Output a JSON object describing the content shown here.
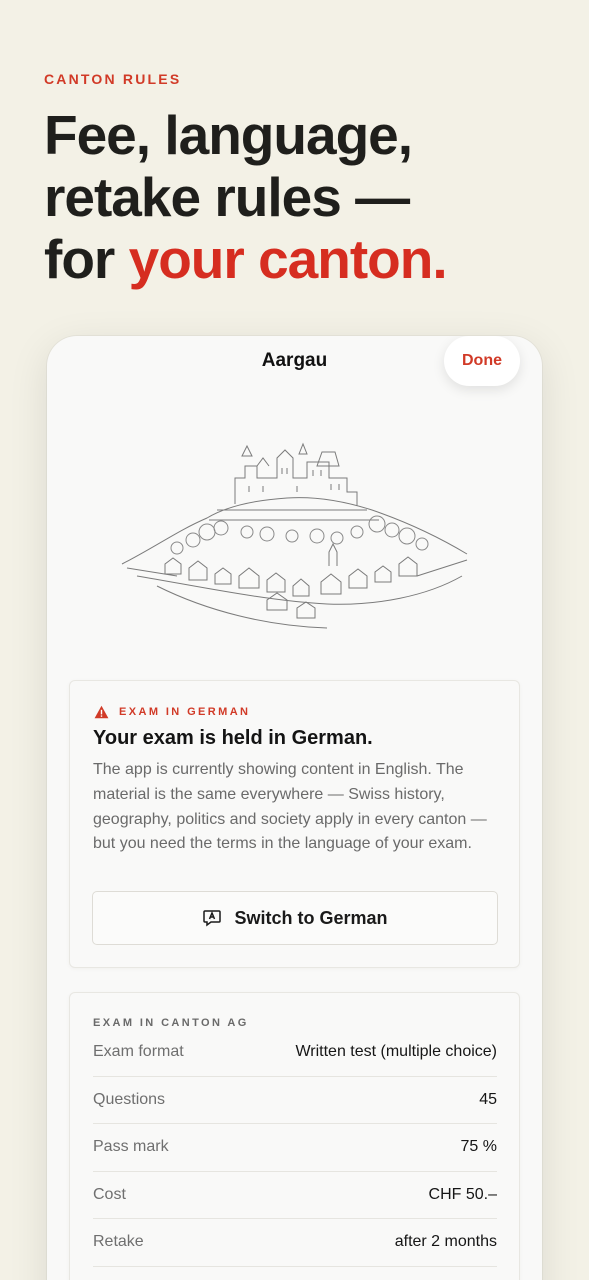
{
  "eyebrow": "CANTON RULES",
  "headline": {
    "line1": "Fee, language,",
    "line2": "retake rules —",
    "line3_prefix": "for ",
    "line3_accent": "your canton."
  },
  "nav": {
    "title": "Aargau",
    "done_label": "Done"
  },
  "alert": {
    "label": "EXAM IN GERMAN",
    "icon": "warning-icon",
    "title": "Your exam is held in German.",
    "body": "The app is currently showing content in English. The material is the same everywhere — Swiss history, geography, politics and society apply in every canton — but you need the terms in the language of your exam.",
    "button_label": "Switch to German",
    "button_icon": "translate-icon"
  },
  "exam_info": {
    "label": "EXAM IN CANTON AG",
    "rows": [
      {
        "key": "Exam format",
        "value": "Written test (multiple choice)"
      },
      {
        "key": "Questions",
        "value": "45"
      },
      {
        "key": "Pass mark",
        "value": "75 %"
      },
      {
        "key": "Cost",
        "value": "CHF 50.–"
      },
      {
        "key": "Retake",
        "value": "after 2 months"
      }
    ]
  },
  "colors": {
    "accent": "#d13a27",
    "background": "#f3f1e6",
    "card": "#f9f9f8"
  }
}
